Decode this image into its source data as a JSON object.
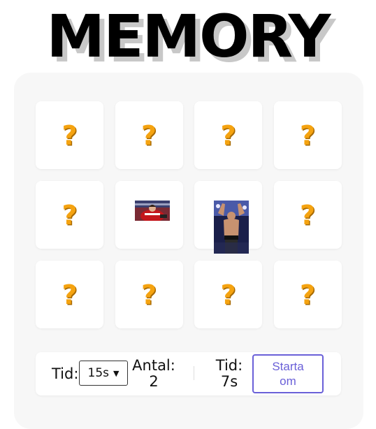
{
  "title": "MEMORY",
  "cards": [
    {
      "state": "hidden",
      "symbol": "?"
    },
    {
      "state": "hidden",
      "symbol": "?"
    },
    {
      "state": "hidden",
      "symbol": "?"
    },
    {
      "state": "hidden",
      "symbol": "?"
    },
    {
      "state": "hidden",
      "symbol": "?"
    },
    {
      "state": "revealed",
      "image": "hockey-player-red-jersey"
    },
    {
      "state": "revealed",
      "image": "wrestler-arms-raised"
    },
    {
      "state": "hidden",
      "symbol": "?"
    },
    {
      "state": "hidden",
      "symbol": "?"
    },
    {
      "state": "hidden",
      "symbol": "?"
    },
    {
      "state": "hidden",
      "symbol": "?"
    },
    {
      "state": "hidden",
      "symbol": "?"
    }
  ],
  "controls": {
    "time_label": "Tid:",
    "time_select_value": "15s",
    "count_label": "Antal:",
    "count_value": "2",
    "elapsed_label": "Tid:",
    "elapsed_value": "7s",
    "restart_label_line1": "Starta",
    "restart_label_line2": "om"
  },
  "colors": {
    "question_mark": "#f5a310",
    "restart_accent": "#6a60d8",
    "board_bg": "#f7f7f7"
  }
}
